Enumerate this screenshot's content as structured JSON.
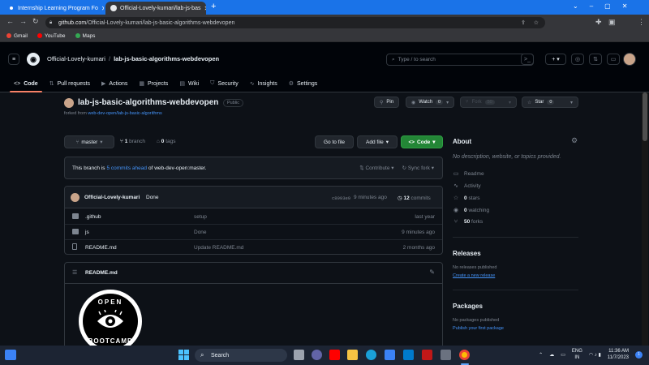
{
  "browser": {
    "tabs": [
      {
        "title": "Internship Learning Program Fo",
        "active": false,
        "favicon_color": "#1a73e8"
      },
      {
        "title": "Official-Lovely-kumari/lab-js-bas",
        "active": true,
        "favicon_color": "#e8eaed"
      }
    ],
    "url_host": "github.com",
    "url_path": "/Official-Lovely-kumari/lab-js-basic-algorithms-webdevopen",
    "bookmarks": [
      {
        "label": "Gmail",
        "color": "#ea4335"
      },
      {
        "label": "YouTube",
        "color": "#ff0000"
      },
      {
        "label": "Maps",
        "color": "#34a853"
      }
    ]
  },
  "header": {
    "owner": "Official-Lovely-kumari",
    "separator": "/",
    "repo": "lab-js-basic-algorithms-webdevopen",
    "search_placeholder": "Type / to search",
    "nav": [
      {
        "label": "Code",
        "icon": "<>",
        "active": true
      },
      {
        "label": "Pull requests",
        "icon": "⇅",
        "active": false
      },
      {
        "label": "Actions",
        "icon": "▶",
        "active": false
      },
      {
        "label": "Projects",
        "icon": "▦",
        "active": false
      },
      {
        "label": "Wiki",
        "icon": "▤",
        "active": false
      },
      {
        "label": "Security",
        "icon": "⛉",
        "active": false
      },
      {
        "label": "Insights",
        "icon": "∿",
        "active": false
      },
      {
        "label": "Settings",
        "icon": "⚙",
        "active": false
      }
    ]
  },
  "repo": {
    "name": "lab-js-basic-algorithms-webdevopen",
    "visibility": "Public",
    "forked_prefix": "forked from",
    "forked_link": "web-dev-open/lab-js-basic-algorithms",
    "pin": "Pin",
    "watch": "Watch",
    "watch_count": "0",
    "fork": "Fork",
    "fork_count": "50",
    "star": "Star",
    "star_count": "0"
  },
  "branch_bar": {
    "branch": "master",
    "branches_count": "1",
    "branches_label": "branch",
    "tags_count": "0",
    "tags_label": "tags",
    "goto_file": "Go to file",
    "add_file": "Add file",
    "code": "Code"
  },
  "ahead": {
    "prefix": "This branch is",
    "link": "5 commits ahead",
    "suffix": "of web-dev-open:master.",
    "contribute": "Contribute",
    "sync": "Sync fork"
  },
  "last_commit": {
    "author": "Official-Lovely-kumari",
    "message": "Done",
    "sha": "c8993e9",
    "time": "9 minutes ago",
    "commits_count": "12",
    "commits_label": "commits"
  },
  "files": [
    {
      "name": ".github",
      "type": "folder",
      "message": "setup",
      "date": "last year"
    },
    {
      "name": "js",
      "type": "folder",
      "message": "Done",
      "date": "9 minutes ago"
    },
    {
      "name": "README.md",
      "type": "file",
      "message": "Update README.md",
      "date": "2 months ago"
    }
  ],
  "readme": {
    "title": "README.md",
    "logo_top": "OPEN",
    "logo_bottom": "BOOTCAMP"
  },
  "about": {
    "title": "About",
    "description": "No description, website, or topics provided.",
    "items": [
      {
        "icon": "book-icon",
        "glyph": "▭",
        "bold": "",
        "label": "Readme"
      },
      {
        "icon": "activity-icon",
        "glyph": "∿",
        "bold": "",
        "label": "Activity"
      },
      {
        "icon": "star-icon",
        "glyph": "☆",
        "bold": "0",
        "label": "stars"
      },
      {
        "icon": "eye-icon",
        "glyph": "◉",
        "bold": "0",
        "label": "watching"
      },
      {
        "icon": "fork-icon",
        "glyph": "⑂",
        "bold": "50",
        "label": "forks"
      }
    ]
  },
  "releases": {
    "title": "Releases",
    "empty": "No releases published",
    "link": "Create a new release"
  },
  "packages": {
    "title": "Packages",
    "empty": "No packages published",
    "link": "Publish your first package"
  },
  "taskbar": {
    "search": "Search",
    "lang": "ENG",
    "region": "IN",
    "time": "11:36 AM",
    "date": "11/7/2023"
  }
}
